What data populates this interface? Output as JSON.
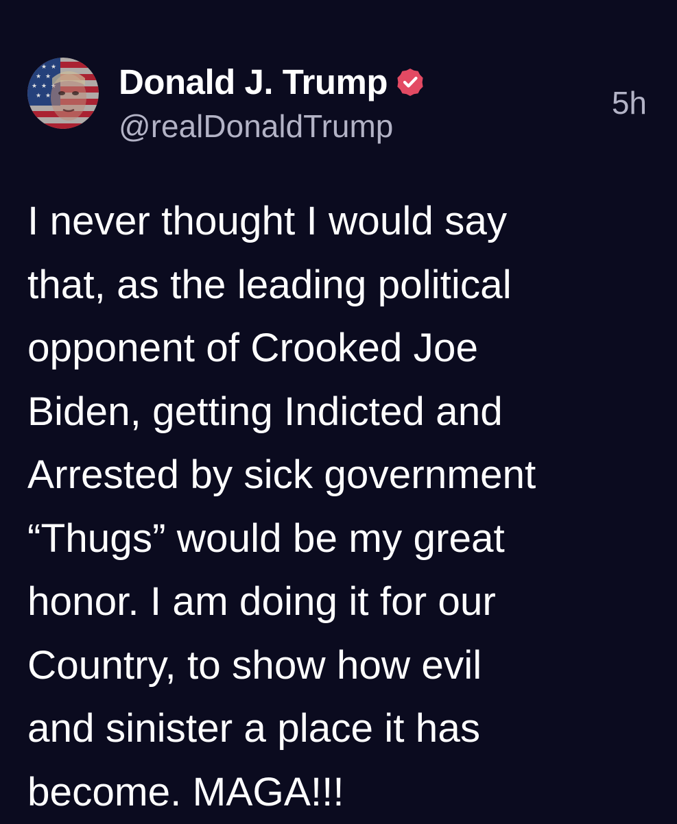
{
  "post": {
    "author": {
      "display_name": "Donald J. Trump",
      "handle": "@realDonaldTrump",
      "verified": true
    },
    "timestamp": "5h",
    "text_lines": [
      "I never thought I would say",
      "that, as the leading political",
      "opponent of Crooked Joe",
      "Biden, getting Indicted and",
      "Arrested by sick government",
      "“Thugs” would be my great",
      "honor. I am doing it for our",
      "Country, to show how evil",
      "and sinister a place it has",
      "become. MAGA!!!"
    ]
  },
  "icons": {
    "avatar": "avatar-flag-portrait-icon",
    "verified": "verified-badge-icon"
  },
  "colors": {
    "background": "#0b0b1f",
    "text_primary": "#ffffff",
    "text_secondary": "#b3b3c6",
    "verified_badge": "#e34a63"
  }
}
